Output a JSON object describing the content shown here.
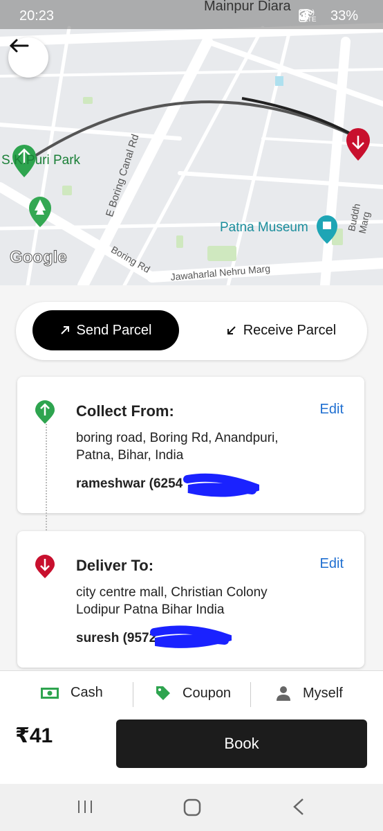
{
  "status_bar": {
    "time": "20:23",
    "location": "Mainpur Diara",
    "network": "Vo) LTE",
    "battery": "33%"
  },
  "map": {
    "places": [
      "S.K.Puri Park",
      "E Boring Canal Rd",
      "Patna Museum",
      "Buddh Marg",
      "Boring Rd",
      "Jawaharlal Nehru Marg"
    ],
    "brand": "Google"
  },
  "mode_toggle": {
    "send_label": "Send Parcel",
    "receive_label": "Receive Parcel",
    "active": "send"
  },
  "pickup": {
    "title": "Collect From:",
    "address": "boring road, Boring Rd, Anandpuri, Patna, Bihar, India",
    "contact": "rameshwar (6254",
    "edit_label": "Edit"
  },
  "dropoff": {
    "title": "Deliver To:",
    "address": "city centre mall, Christian Colony Lodipur Patna Bihar India",
    "contact": "suresh (9572",
    "edit_label": "Edit"
  },
  "options": {
    "payment": "Cash",
    "coupon": "Coupon",
    "recipient": "Myself"
  },
  "price": "₹41",
  "book_label": "Book",
  "colors": {
    "pickup_pin": "#2ea44f",
    "drop_pin": "#c8102e",
    "link": "#1f6fd1",
    "primary": "#000000"
  }
}
